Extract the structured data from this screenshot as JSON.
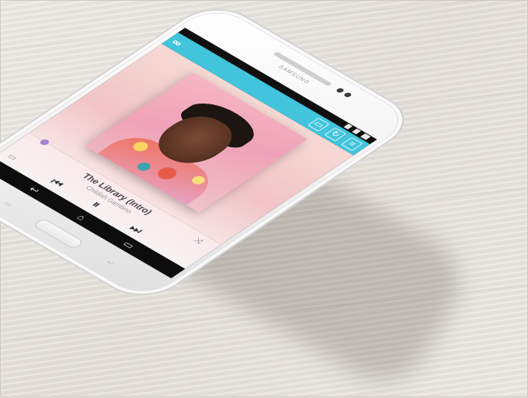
{
  "device": {
    "brand_label": "SAMSUNG",
    "body_color": "#f4f4f4"
  },
  "app": {
    "accent_color": "#41c4dc",
    "logo_icon": "infinity-icon",
    "toolbar_icons": [
      "cast-icon",
      "refresh-icon",
      "menu-icon"
    ]
  },
  "now_playing": {
    "title": "The Library (Intro)",
    "artist": "Childish Gambino",
    "progress_fraction": 0.05,
    "progress_color": "#a783d6",
    "shuffle_label": "⤨"
  },
  "nav": {
    "back_icon": "back-icon",
    "home_icon": "home-icon",
    "recents_icon": "recents-icon"
  }
}
